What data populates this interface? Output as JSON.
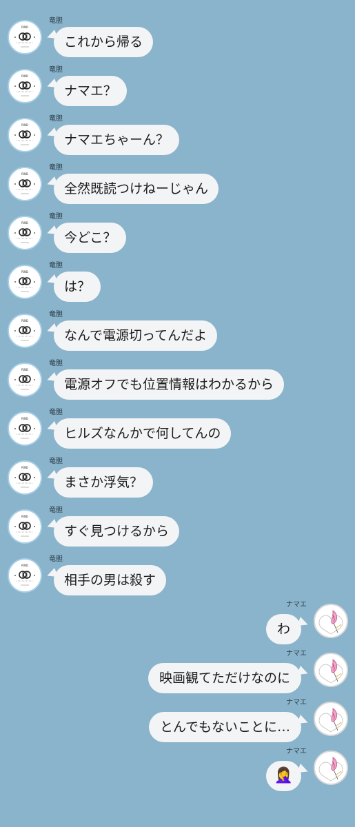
{
  "theme": {
    "background": "#8ab4cc",
    "bubble": "#f3f4f5",
    "text": "#1c1c1c"
  },
  "messages": [
    {
      "side": "left",
      "sender": "竜胆",
      "text": "これから帰る",
      "avatar": "ryudan-avatar-icon"
    },
    {
      "side": "left",
      "sender": "竜胆",
      "text": "ナマエ？",
      "avatar": "ryudan-avatar-icon"
    },
    {
      "side": "left",
      "sender": "竜胆",
      "text": "ナマエちゃーん？",
      "avatar": "ryudan-avatar-icon"
    },
    {
      "side": "left",
      "sender": "竜胆",
      "text": "全然既読つけねーじゃん",
      "avatar": "ryudan-avatar-icon"
    },
    {
      "side": "left",
      "sender": "竜胆",
      "text": "今どこ？",
      "avatar": "ryudan-avatar-icon"
    },
    {
      "side": "left",
      "sender": "竜胆",
      "text": "は？",
      "avatar": "ryudan-avatar-icon"
    },
    {
      "side": "left",
      "sender": "竜胆",
      "text": "なんで電源切ってんだよ",
      "avatar": "ryudan-avatar-icon"
    },
    {
      "side": "left",
      "sender": "竜胆",
      "text": "電源オフでも位置情報はわかるから",
      "avatar": "ryudan-avatar-icon"
    },
    {
      "side": "left",
      "sender": "竜胆",
      "text": "ヒルズなんかで何してんの",
      "avatar": "ryudan-avatar-icon"
    },
    {
      "side": "left",
      "sender": "竜胆",
      "text": "まさか浮気？",
      "avatar": "ryudan-avatar-icon"
    },
    {
      "side": "left",
      "sender": "竜胆",
      "text": "すぐ見つけるから",
      "avatar": "ryudan-avatar-icon"
    },
    {
      "side": "left",
      "sender": "竜胆",
      "text": "相手の男は殺す",
      "avatar": "ryudan-avatar-icon"
    },
    {
      "side": "right",
      "sender": "ナマエ",
      "text": "わ",
      "avatar": "flower-avatar-icon"
    },
    {
      "side": "right",
      "sender": "ナマエ",
      "text": "映画観てただけなのに",
      "avatar": "flower-avatar-icon"
    },
    {
      "side": "right",
      "sender": "ナマエ",
      "text": "とんでもないことに…",
      "avatar": "flower-avatar-icon"
    },
    {
      "side": "right",
      "sender": "ナマエ",
      "text": "🤦‍♀️",
      "avatar": "flower-avatar-icon",
      "emoji": true
    }
  ]
}
